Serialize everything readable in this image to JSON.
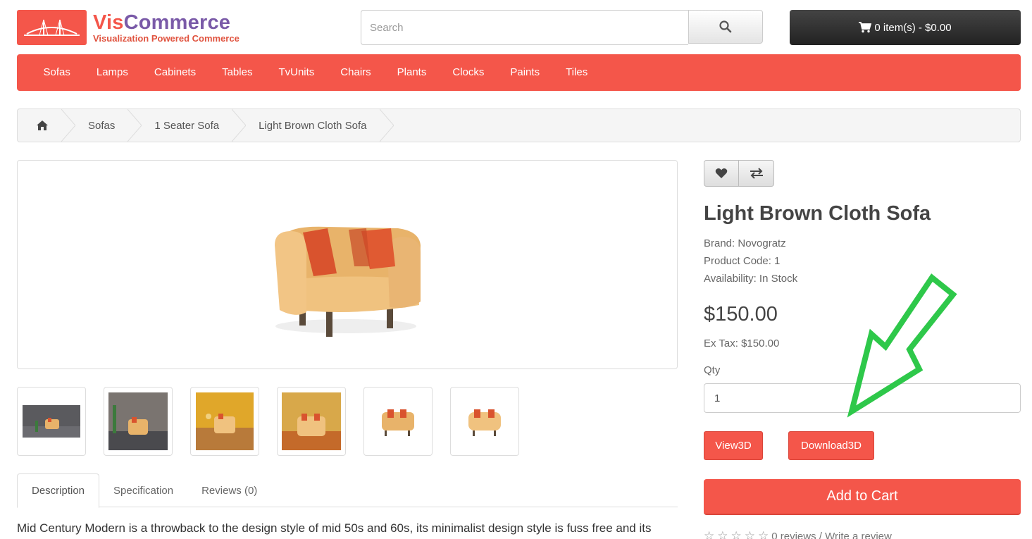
{
  "logo": {
    "title_part1": "Vis",
    "title_part2": "Commerce",
    "subtitle": "Visualization Powered Commerce"
  },
  "search": {
    "placeholder": "Search",
    "value": ""
  },
  "cart": {
    "label": "0 item(s) - $0.00"
  },
  "nav": {
    "items": [
      "Sofas",
      "Lamps",
      "Cabinets",
      "Tables",
      "TvUnits",
      "Chairs",
      "Plants",
      "Clocks",
      "Paints",
      "Tiles"
    ]
  },
  "breadcrumb": {
    "items": [
      "Sofas",
      "1 Seater Sofa",
      "Light Brown Cloth Sofa"
    ]
  },
  "product": {
    "title": "Light Brown Cloth Sofa",
    "brand": "Brand: Novogratz",
    "code": "Product Code: 1",
    "availability": "Availability: In Stock",
    "price": "$150.00",
    "ex_tax": "Ex Tax: $150.00",
    "qty_label": "Qty",
    "qty_value": "1",
    "view3d": "View3D",
    "download3d": "Download3D",
    "add_to_cart": "Add to Cart",
    "reviews_text": "0 reviews / Write a review",
    "rating_stars": 0
  },
  "tabs": [
    "Description",
    "Specification",
    "Reviews (0)"
  ],
  "description": "Mid Century Modern is a throwback to the design style of mid 50s and 60s, its minimalist design style is fuss free and its",
  "colors": {
    "brand_red": "#f4564a",
    "cart_dark": "#2b2b2b",
    "annotation_green": "#2ec84a"
  },
  "icons": [
    "home-icon",
    "search-icon",
    "cart-icon",
    "heart-icon",
    "compare-icon",
    "star-icon"
  ]
}
